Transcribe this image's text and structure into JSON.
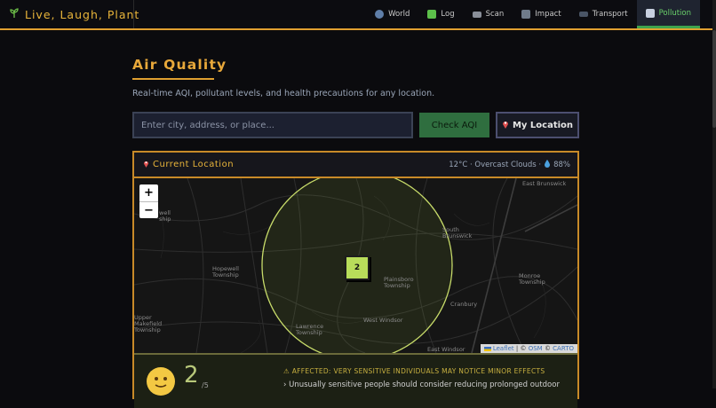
{
  "nav": {
    "brand": "Live, Laugh, Plant",
    "items": [
      {
        "label": "World",
        "icon": "globe-icon",
        "color": "#5f7ea8"
      },
      {
        "label": "Log",
        "icon": "check-box-icon",
        "color": "#5cbf4a"
      },
      {
        "label": "Scan",
        "icon": "scanner-icon",
        "color": "#8a8f99"
      },
      {
        "label": "Impact",
        "icon": "chart-icon",
        "color": "#6f7b8a"
      },
      {
        "label": "Transport",
        "icon": "car-icon",
        "color": "#4a5566"
      },
      {
        "label": "Pollution",
        "icon": "pollution-icon",
        "color": "#c8d0e0",
        "active": true
      }
    ]
  },
  "page": {
    "title": "Air Quality",
    "subtitle": "Real-time AQI, pollutant levels, and health precautions for any location."
  },
  "search": {
    "placeholder": "Enter city, address, or place...",
    "value": "",
    "check_label": "Check AQI",
    "location_label": "My Location"
  },
  "panel": {
    "title": "Current Location",
    "weather": "12°C · Overcast Clouds · ",
    "humidity": "88%"
  },
  "map": {
    "cluster_count": "2",
    "labels": {
      "east_brunswick": "East Brunswick",
      "south_brunswick": "South Brunswick",
      "hopewell": "Hopewell Township",
      "plainsboro": "Plainsboro Township",
      "monroe": "Monroe Township",
      "cranbury": "Cranbury",
      "west_windsor": "West Windsor",
      "lawrence": "Lawrence Township",
      "upper_makefield": "Upper Makefield Township",
      "east_windsor": "East Windsor",
      "partial_township": "well ship"
    },
    "attribution": {
      "leaflet": "Leaflet",
      "sep1": " | © ",
      "osm": "OSM",
      "sep2": " © ",
      "carto": "CARTO"
    }
  },
  "aqi": {
    "value": "2",
    "scale": "/5",
    "warning": "⚠ AFFECTED: VERY SENSITIVE INDIVIDUALS MAY NOTICE MINOR EFFECTS",
    "tip": "›  Unusually sensitive people should consider reducing prolonged outdoor"
  }
}
